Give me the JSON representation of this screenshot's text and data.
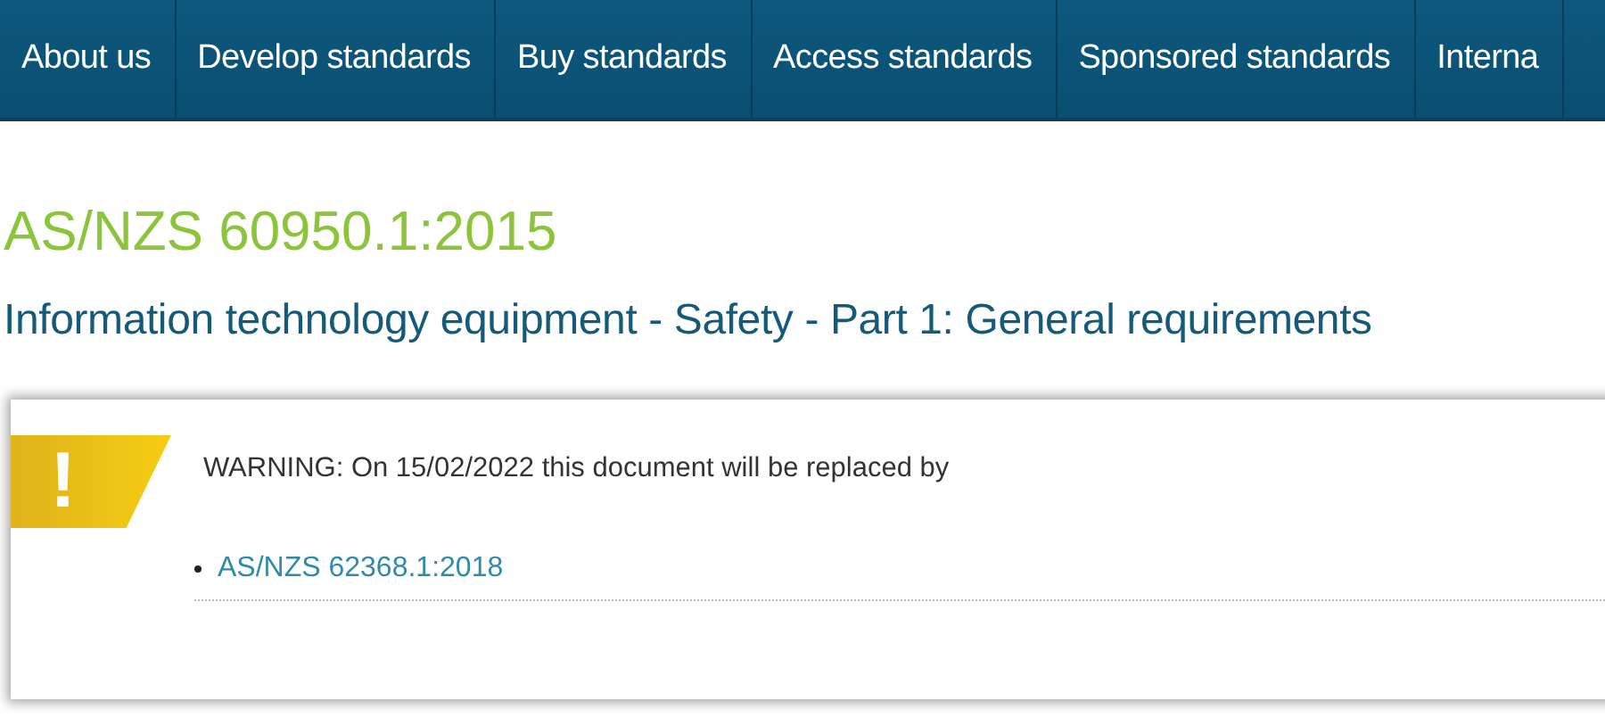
{
  "nav": {
    "items": [
      {
        "label": "About us"
      },
      {
        "label": "Develop standards"
      },
      {
        "label": "Buy standards"
      },
      {
        "label": "Access standards"
      },
      {
        "label": "Sponsored standards"
      },
      {
        "label": "Interna"
      }
    ]
  },
  "standard": {
    "code": "AS/NZS 60950.1:2015",
    "title": "Information technology equipment - Safety - Part 1: General requirements"
  },
  "warning": {
    "badge": "!",
    "message": "WARNING:  On 15/02/2022 this document will be replaced by",
    "replacements": [
      "AS/NZS 62368.1:2018"
    ]
  }
}
